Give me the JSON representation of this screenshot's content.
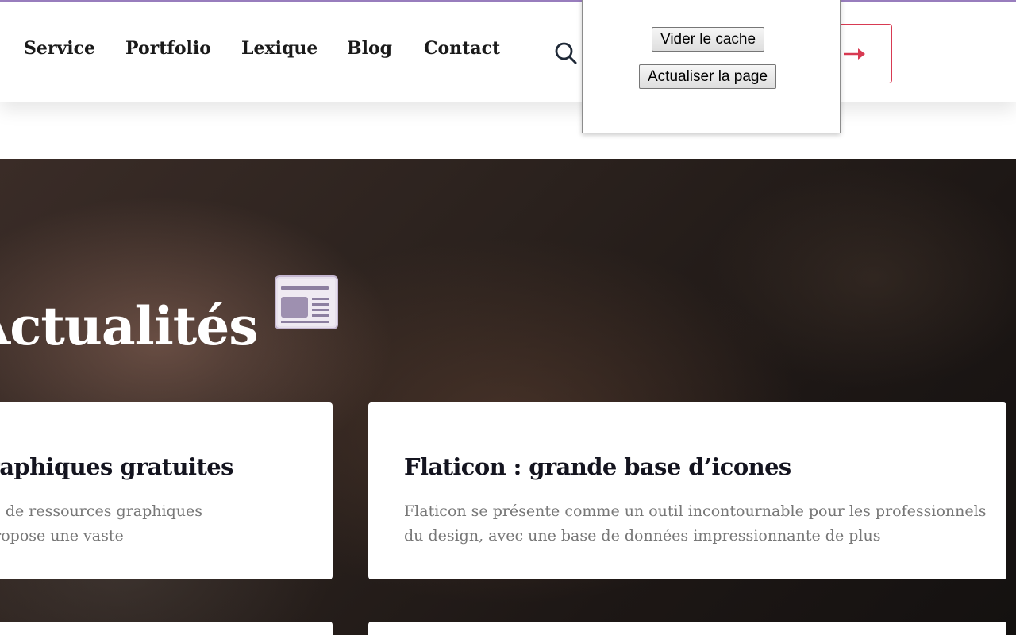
{
  "header": {
    "nav": [
      {
        "label": "Service"
      },
      {
        "label": "Portfolio"
      },
      {
        "label": "Lexique"
      },
      {
        "label": "Blog"
      },
      {
        "label": "Contact"
      }
    ],
    "search_icon": "search-icon",
    "cta_icon": "arrow-right-icon",
    "accent_color": "#d83a52",
    "top_bar_color": "#9b7fc0"
  },
  "popup": {
    "clear_cache_label": "Vider le cache",
    "refresh_label": "Actualiser la page"
  },
  "hero": {
    "title": "Actualités",
    "icon": "newspaper-icon"
  },
  "cards": [
    {
      "title": "Ressources graphiques gratuites",
      "text_line_1": "Une plateforme de ressources graphiques",
      "text_line_2": "et photos. Elle propose une vaste"
    },
    {
      "title": "Flaticon : grande base d’icones",
      "text_line_1": "Flaticon se présente comme un outil incontournable pour les professionnels",
      "text_line_2": "du design, avec une base de données impressionnante de plus"
    }
  ]
}
